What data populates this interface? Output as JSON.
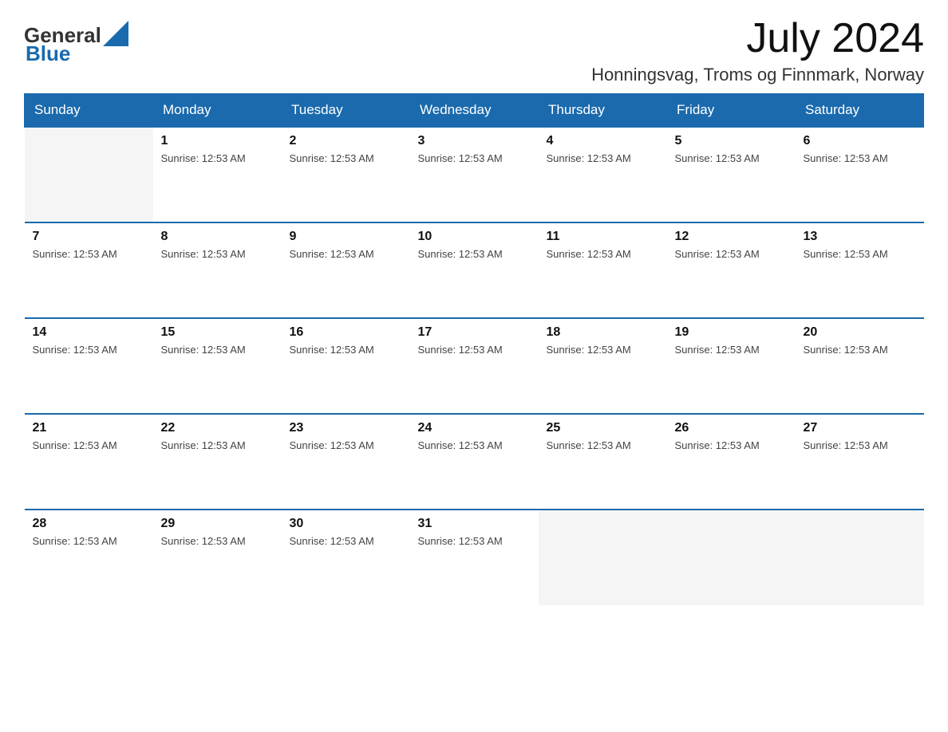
{
  "logo": {
    "text_general": "General",
    "text_blue": "Blue"
  },
  "title": "July 2024",
  "location": "Honningsvag, Troms og Finnmark, Norway",
  "days_of_week": [
    "Sunday",
    "Monday",
    "Tuesday",
    "Wednesday",
    "Thursday",
    "Friday",
    "Saturday"
  ],
  "sunrise_label": "Sunrise: 12:53 AM",
  "weeks": [
    [
      {
        "day": "",
        "sunrise": "",
        "empty": true
      },
      {
        "day": "1",
        "sunrise": "Sunrise: 12:53 AM",
        "empty": false
      },
      {
        "day": "2",
        "sunrise": "Sunrise: 12:53 AM",
        "empty": false
      },
      {
        "day": "3",
        "sunrise": "Sunrise: 12:53 AM",
        "empty": false
      },
      {
        "day": "4",
        "sunrise": "Sunrise: 12:53 AM",
        "empty": false
      },
      {
        "day": "5",
        "sunrise": "Sunrise: 12:53 AM",
        "empty": false
      },
      {
        "day": "6",
        "sunrise": "Sunrise: 12:53 AM",
        "empty": false
      }
    ],
    [
      {
        "day": "7",
        "sunrise": "Sunrise: 12:53 AM",
        "empty": false
      },
      {
        "day": "8",
        "sunrise": "Sunrise: 12:53 AM",
        "empty": false
      },
      {
        "day": "9",
        "sunrise": "Sunrise: 12:53 AM",
        "empty": false
      },
      {
        "day": "10",
        "sunrise": "Sunrise: 12:53 AM",
        "empty": false
      },
      {
        "day": "11",
        "sunrise": "Sunrise: 12:53 AM",
        "empty": false
      },
      {
        "day": "12",
        "sunrise": "Sunrise: 12:53 AM",
        "empty": false
      },
      {
        "day": "13",
        "sunrise": "Sunrise: 12:53 AM",
        "empty": false
      }
    ],
    [
      {
        "day": "14",
        "sunrise": "Sunrise: 12:53 AM",
        "empty": false
      },
      {
        "day": "15",
        "sunrise": "Sunrise: 12:53 AM",
        "empty": false
      },
      {
        "day": "16",
        "sunrise": "Sunrise: 12:53 AM",
        "empty": false
      },
      {
        "day": "17",
        "sunrise": "Sunrise: 12:53 AM",
        "empty": false
      },
      {
        "day": "18",
        "sunrise": "Sunrise: 12:53 AM",
        "empty": false
      },
      {
        "day": "19",
        "sunrise": "Sunrise: 12:53 AM",
        "empty": false
      },
      {
        "day": "20",
        "sunrise": "Sunrise: 12:53 AM",
        "empty": false
      }
    ],
    [
      {
        "day": "21",
        "sunrise": "Sunrise: 12:53 AM",
        "empty": false
      },
      {
        "day": "22",
        "sunrise": "Sunrise: 12:53 AM",
        "empty": false
      },
      {
        "day": "23",
        "sunrise": "Sunrise: 12:53 AM",
        "empty": false
      },
      {
        "day": "24",
        "sunrise": "Sunrise: 12:53 AM",
        "empty": false
      },
      {
        "day": "25",
        "sunrise": "Sunrise: 12:53 AM",
        "empty": false
      },
      {
        "day": "26",
        "sunrise": "Sunrise: 12:53 AM",
        "empty": false
      },
      {
        "day": "27",
        "sunrise": "Sunrise: 12:53 AM",
        "empty": false
      }
    ],
    [
      {
        "day": "28",
        "sunrise": "Sunrise: 12:53 AM",
        "empty": false
      },
      {
        "day": "29",
        "sunrise": "Sunrise: 12:53 AM",
        "empty": false
      },
      {
        "day": "30",
        "sunrise": "Sunrise: 12:53 AM",
        "empty": false
      },
      {
        "day": "31",
        "sunrise": "Sunrise: 12:53 AM",
        "empty": false
      },
      {
        "day": "",
        "sunrise": "",
        "empty": true
      },
      {
        "day": "",
        "sunrise": "",
        "empty": true
      },
      {
        "day": "",
        "sunrise": "",
        "empty": true
      }
    ]
  ]
}
